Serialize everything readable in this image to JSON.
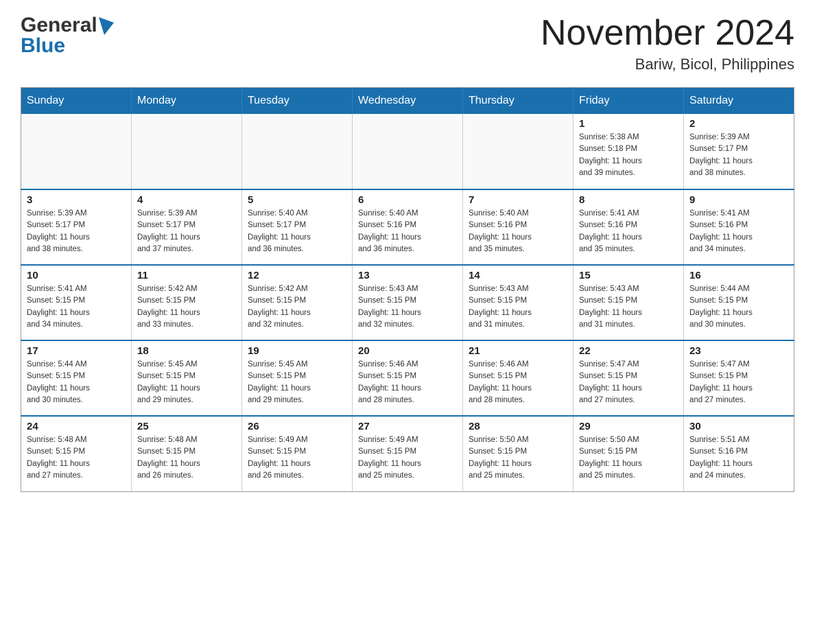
{
  "logo": {
    "general": "General",
    "blue": "Blue"
  },
  "header": {
    "month_year": "November 2024",
    "location": "Bariw, Bicol, Philippines"
  },
  "weekdays": [
    "Sunday",
    "Monday",
    "Tuesday",
    "Wednesday",
    "Thursday",
    "Friday",
    "Saturday"
  ],
  "weeks": [
    [
      {
        "day": "",
        "info": ""
      },
      {
        "day": "",
        "info": ""
      },
      {
        "day": "",
        "info": ""
      },
      {
        "day": "",
        "info": ""
      },
      {
        "day": "",
        "info": ""
      },
      {
        "day": "1",
        "info": "Sunrise: 5:38 AM\nSunset: 5:18 PM\nDaylight: 11 hours\nand 39 minutes."
      },
      {
        "day": "2",
        "info": "Sunrise: 5:39 AM\nSunset: 5:17 PM\nDaylight: 11 hours\nand 38 minutes."
      }
    ],
    [
      {
        "day": "3",
        "info": "Sunrise: 5:39 AM\nSunset: 5:17 PM\nDaylight: 11 hours\nand 38 minutes."
      },
      {
        "day": "4",
        "info": "Sunrise: 5:39 AM\nSunset: 5:17 PM\nDaylight: 11 hours\nand 37 minutes."
      },
      {
        "day": "5",
        "info": "Sunrise: 5:40 AM\nSunset: 5:17 PM\nDaylight: 11 hours\nand 36 minutes."
      },
      {
        "day": "6",
        "info": "Sunrise: 5:40 AM\nSunset: 5:16 PM\nDaylight: 11 hours\nand 36 minutes."
      },
      {
        "day": "7",
        "info": "Sunrise: 5:40 AM\nSunset: 5:16 PM\nDaylight: 11 hours\nand 35 minutes."
      },
      {
        "day": "8",
        "info": "Sunrise: 5:41 AM\nSunset: 5:16 PM\nDaylight: 11 hours\nand 35 minutes."
      },
      {
        "day": "9",
        "info": "Sunrise: 5:41 AM\nSunset: 5:16 PM\nDaylight: 11 hours\nand 34 minutes."
      }
    ],
    [
      {
        "day": "10",
        "info": "Sunrise: 5:41 AM\nSunset: 5:15 PM\nDaylight: 11 hours\nand 34 minutes."
      },
      {
        "day": "11",
        "info": "Sunrise: 5:42 AM\nSunset: 5:15 PM\nDaylight: 11 hours\nand 33 minutes."
      },
      {
        "day": "12",
        "info": "Sunrise: 5:42 AM\nSunset: 5:15 PM\nDaylight: 11 hours\nand 32 minutes."
      },
      {
        "day": "13",
        "info": "Sunrise: 5:43 AM\nSunset: 5:15 PM\nDaylight: 11 hours\nand 32 minutes."
      },
      {
        "day": "14",
        "info": "Sunrise: 5:43 AM\nSunset: 5:15 PM\nDaylight: 11 hours\nand 31 minutes."
      },
      {
        "day": "15",
        "info": "Sunrise: 5:43 AM\nSunset: 5:15 PM\nDaylight: 11 hours\nand 31 minutes."
      },
      {
        "day": "16",
        "info": "Sunrise: 5:44 AM\nSunset: 5:15 PM\nDaylight: 11 hours\nand 30 minutes."
      }
    ],
    [
      {
        "day": "17",
        "info": "Sunrise: 5:44 AM\nSunset: 5:15 PM\nDaylight: 11 hours\nand 30 minutes."
      },
      {
        "day": "18",
        "info": "Sunrise: 5:45 AM\nSunset: 5:15 PM\nDaylight: 11 hours\nand 29 minutes."
      },
      {
        "day": "19",
        "info": "Sunrise: 5:45 AM\nSunset: 5:15 PM\nDaylight: 11 hours\nand 29 minutes."
      },
      {
        "day": "20",
        "info": "Sunrise: 5:46 AM\nSunset: 5:15 PM\nDaylight: 11 hours\nand 28 minutes."
      },
      {
        "day": "21",
        "info": "Sunrise: 5:46 AM\nSunset: 5:15 PM\nDaylight: 11 hours\nand 28 minutes."
      },
      {
        "day": "22",
        "info": "Sunrise: 5:47 AM\nSunset: 5:15 PM\nDaylight: 11 hours\nand 27 minutes."
      },
      {
        "day": "23",
        "info": "Sunrise: 5:47 AM\nSunset: 5:15 PM\nDaylight: 11 hours\nand 27 minutes."
      }
    ],
    [
      {
        "day": "24",
        "info": "Sunrise: 5:48 AM\nSunset: 5:15 PM\nDaylight: 11 hours\nand 27 minutes."
      },
      {
        "day": "25",
        "info": "Sunrise: 5:48 AM\nSunset: 5:15 PM\nDaylight: 11 hours\nand 26 minutes."
      },
      {
        "day": "26",
        "info": "Sunrise: 5:49 AM\nSunset: 5:15 PM\nDaylight: 11 hours\nand 26 minutes."
      },
      {
        "day": "27",
        "info": "Sunrise: 5:49 AM\nSunset: 5:15 PM\nDaylight: 11 hours\nand 25 minutes."
      },
      {
        "day": "28",
        "info": "Sunrise: 5:50 AM\nSunset: 5:15 PM\nDaylight: 11 hours\nand 25 minutes."
      },
      {
        "day": "29",
        "info": "Sunrise: 5:50 AM\nSunset: 5:15 PM\nDaylight: 11 hours\nand 25 minutes."
      },
      {
        "day": "30",
        "info": "Sunrise: 5:51 AM\nSunset: 5:16 PM\nDaylight: 11 hours\nand 24 minutes."
      }
    ]
  ]
}
